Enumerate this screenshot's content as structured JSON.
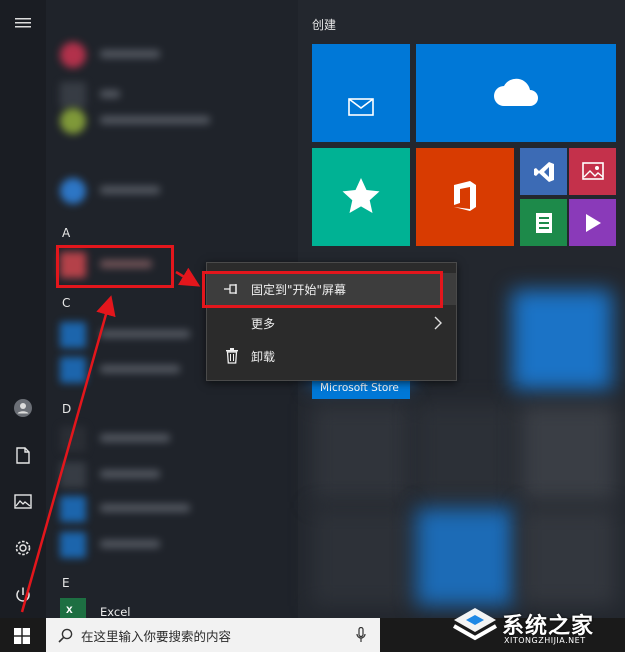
{
  "app_list": {
    "letter_a": "A",
    "letter_c": "C",
    "letter_d": "D",
    "letter_e": "E",
    "excel_label": "Excel"
  },
  "tiles": {
    "group_title": "创建",
    "store_label": "Microsoft Store"
  },
  "context_menu": {
    "pin_label": "固定到\"开始\"屏幕",
    "more_label": "更多",
    "uninstall_label": "卸载"
  },
  "taskbar": {
    "search_placeholder": "在这里输入你要搜索的内容"
  },
  "watermark": {
    "brand_cn": "系统之家",
    "brand_url": "XITONGZHIJIA.NET"
  },
  "colors": {
    "accent_red": "#e3161c",
    "tile_blue": "#0078d7",
    "tile_teal": "#00b294",
    "tile_orange": "#d83b01"
  }
}
